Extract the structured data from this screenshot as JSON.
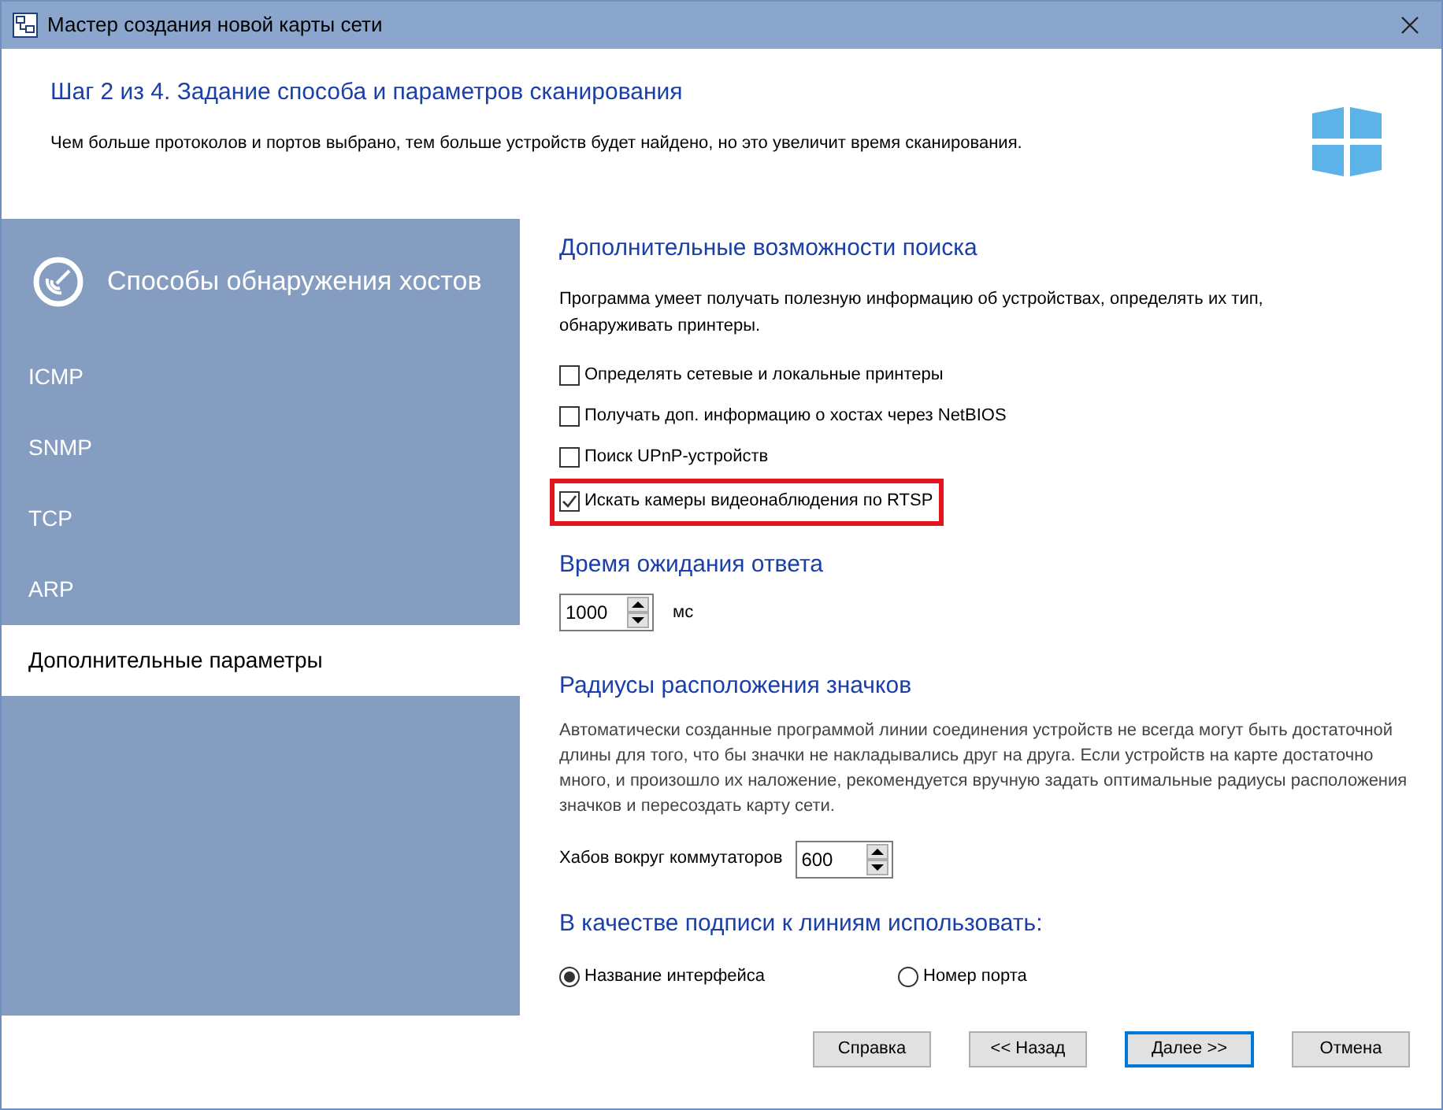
{
  "window": {
    "title": "Мастер создания новой карты сети"
  },
  "header": {
    "step": "Шаг 2 из 4. Задание способа и параметров сканирования",
    "description": "Чем больше протоколов и портов выбрано, тем больше устройств будет найдено, но это увеличит время сканирования."
  },
  "sidebar": {
    "title": "Способы обнаружения хостов",
    "items": [
      {
        "label": "ICMP",
        "selected": false
      },
      {
        "label": "SNMP",
        "selected": false
      },
      {
        "label": "TCP",
        "selected": false
      },
      {
        "label": "ARP",
        "selected": false
      },
      {
        "label": "Дополнительные параметры",
        "selected": true
      }
    ]
  },
  "search_options": {
    "title": "Дополнительные возможности поиска",
    "description": "Программа умеет получать полезную информацию об устройствах, определять их тип, обнаруживать принтеры.",
    "options": [
      {
        "label": "Определять сетевые и локальные принтеры",
        "checked": false,
        "highlighted": false
      },
      {
        "label": "Получать доп. информацию о хостах через NetBIOS",
        "checked": false,
        "highlighted": false
      },
      {
        "label": "Поиск UPnP-устройств",
        "checked": false,
        "highlighted": false
      },
      {
        "label": "Искать камеры видеонаблюдения по RTSP",
        "checked": true,
        "highlighted": true
      }
    ]
  },
  "timeout": {
    "title": "Время ожидания ответа",
    "value": "1000",
    "unit": "мс"
  },
  "radii": {
    "title": "Радиусы расположения значков",
    "description": "Автоматически созданные программой линии соединения устройств не всегда могут быть достаточной длины для того, что бы значки не накладывались друг на друга. Если устройств на карте достаточно много, и произошло их наложение, рекомендуется вручную задать оптимальные радиусы расположения значков и пересоздать карту сети.",
    "label": "Хабов вокруг коммутаторов",
    "value": "600"
  },
  "line_labels": {
    "title": "В качестве подписи к линиям использовать:",
    "options": [
      {
        "label": "Название интерфейса",
        "selected": true
      },
      {
        "label": "Номер порта",
        "selected": false
      }
    ]
  },
  "buttons": [
    {
      "label": "Справка",
      "default": false
    },
    {
      "label": "<< Назад",
      "default": false
    },
    {
      "label": "Далее >>",
      "default": true
    },
    {
      "label": "Отмена",
      "default": false
    }
  ]
}
